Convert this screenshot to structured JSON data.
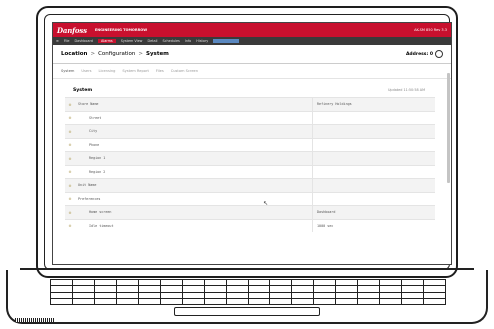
{
  "header": {
    "logo": "Danfoss",
    "app_name": "ENGINEERING TOMORROW",
    "device_info": "AK-SM 850 Rev 3.3"
  },
  "menu": {
    "items": [
      "≡",
      "File",
      "Dashboard",
      "Alarms",
      "System View",
      "Detail",
      "Schedules",
      "Info",
      "History"
    ],
    "active_index": 3
  },
  "breadcrumb": {
    "items": [
      "Location",
      "Configuration",
      "System"
    ],
    "separator": ">",
    "address_label": "Address: 0"
  },
  "tabs": [
    "System",
    "Users",
    "Licensing",
    "System Report",
    "Files",
    "Custom Screen"
  ],
  "section": {
    "title": "System",
    "updated": "Updated 11:50:58 AM"
  },
  "table": {
    "rows": [
      {
        "label": "Store Name",
        "value": "Refinery Holdings",
        "indent": 1
      },
      {
        "label": "Street",
        "value": "",
        "indent": 2
      },
      {
        "label": "City",
        "value": "",
        "indent": 2
      },
      {
        "label": "Phone",
        "value": "",
        "indent": 2
      },
      {
        "label": "Region 1",
        "value": "",
        "indent": 2
      },
      {
        "label": "Region 2",
        "value": "",
        "indent": 2
      },
      {
        "label": "Unit Name",
        "value": "",
        "indent": 1
      },
      {
        "label": "Preferences",
        "value": "",
        "indent": 1
      },
      {
        "label": "Home screen",
        "value": "Dashboard",
        "indent": 2
      },
      {
        "label": "Idle timeout",
        "value": "1000 sec",
        "indent": 2
      }
    ]
  },
  "icons": {
    "row_icon": "gear-icon",
    "settings": "gear-icon"
  },
  "colors": {
    "brand": "#c8102e",
    "menu_bg": "#3a3a3a"
  }
}
